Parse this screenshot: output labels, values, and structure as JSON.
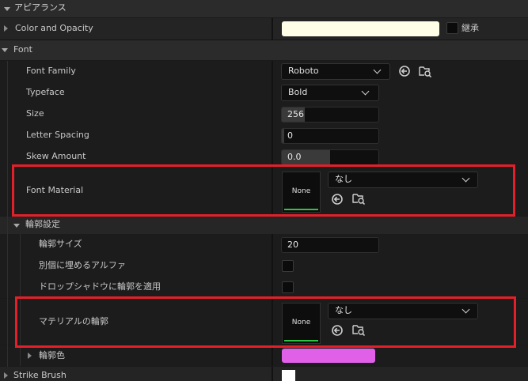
{
  "section": {
    "title": "アピアランス"
  },
  "color_opacity": {
    "label": "Color and Opacity",
    "color": "#FFFFE8",
    "inherit_label": "継承"
  },
  "font": {
    "title": "Font",
    "family": {
      "label": "Font Family",
      "value": "Roboto"
    },
    "typeface": {
      "label": "Typeface",
      "value": "Bold"
    },
    "size": {
      "label": "Size",
      "value": "256"
    },
    "letter_spacing": {
      "label": "Letter Spacing",
      "value": "0"
    },
    "skew_amount": {
      "label": "Skew Amount",
      "value": "0.0"
    },
    "material": {
      "label": "Font Material",
      "thumb": "None",
      "value": "なし"
    }
  },
  "outline": {
    "title": "輪郭設定",
    "size": {
      "label": "輪郭サイズ",
      "value": "20"
    },
    "separate_alpha": {
      "label": "別個に埋めるアルファ"
    },
    "apply_shadow": {
      "label": "ドロップシャドウに輪郭を適用"
    },
    "material": {
      "label": "マテリアルの輪郭",
      "thumb": "None",
      "value": "なし"
    },
    "color": {
      "label": "輪郭色",
      "value": "#E060E8"
    }
  },
  "strike_brush": {
    "label": "Strike Brush"
  },
  "colors": {
    "highlight": "#E3202A",
    "accent_green": "#2EC443"
  }
}
